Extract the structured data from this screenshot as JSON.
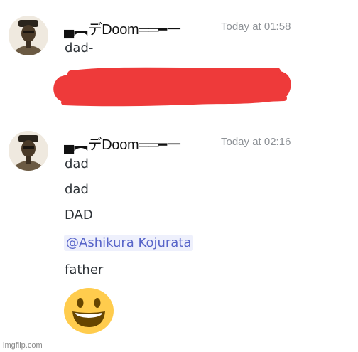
{
  "messages": [
    {
      "username": "▄︻デDoom══━一",
      "timestamp": "Today at 01:58",
      "lines": [
        "dad-"
      ],
      "has_redaction": true,
      "redaction_color": "#ee3a3a"
    },
    {
      "username": "▄︻デDoom══━一",
      "timestamp": "Today at 02:16",
      "lines": [
        "dad",
        "dad",
        "DAD"
      ],
      "mention": "@Ashikura Kojurata",
      "after_mention": "father",
      "emoji": "smiley-face-emoji"
    }
  ],
  "watermark": "imgflip.com",
  "colors": {
    "mention_bg": "#eef0fc",
    "mention_text": "#5865c9",
    "timestamp": "#8e9297",
    "emoji_yellow": "#ffcc4d"
  }
}
